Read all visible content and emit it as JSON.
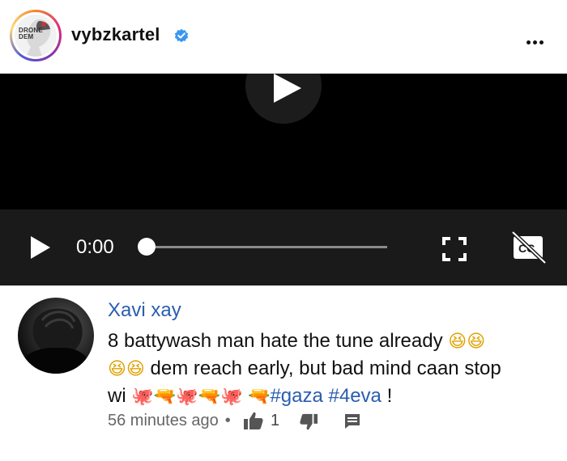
{
  "header": {
    "avatar_text": "DRONE DEM",
    "username": "vybzkartel",
    "more_icon": "more-horizontal-icon",
    "verified_color": "#3897f0"
  },
  "video": {
    "time": "0:00",
    "progress": 0,
    "icons": [
      "play-icon",
      "fullscreen-icon",
      "closed-captions-off-icon"
    ]
  },
  "comment": {
    "author": "Xavi xay",
    "text_line1": "8 battywash man hate the tune already",
    "text_line2": "dem reach early, but bad mind caan stop",
    "text_line3_prefix": "wi",
    "hashtags": [
      "#gaza",
      "#4eva"
    ],
    "text_end": "!",
    "time_ago": "56 minutes ago",
    "separator": "•",
    "likes": "1"
  },
  "colors": {
    "link": "#2a5db0",
    "video_bg": "#000000",
    "controls_bg": "#1a1a1a"
  }
}
